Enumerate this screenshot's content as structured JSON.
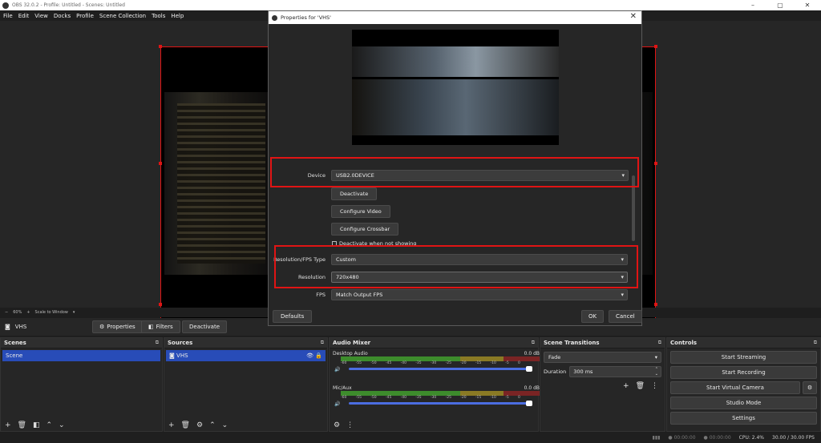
{
  "window": {
    "title": "OBS 32.0.2 - Profile: Untitled - Scenes: Untitled"
  },
  "menu": [
    "File",
    "Edit",
    "View",
    "Docks",
    "Profile",
    "Scene Collection",
    "Tools",
    "Help"
  ],
  "zoom": {
    "value": "60%",
    "scale_mode": "Scale to Window"
  },
  "source_bar": {
    "name": "VHS",
    "properties": "Properties",
    "filters": "Filters",
    "deactivate": "Deactivate"
  },
  "scenes": {
    "title": "Scenes",
    "items": [
      "Scene"
    ]
  },
  "sources": {
    "title": "Sources",
    "items": [
      "VHS"
    ]
  },
  "mixer": {
    "title": "Audio Mixer",
    "tracks": [
      {
        "name": "Desktop Audio",
        "db": "0.0 dB"
      },
      {
        "name": "Mic/Aux",
        "db": "0.0 dB"
      }
    ],
    "ticks": [
      "-60",
      "-55",
      "-50",
      "-45",
      "-40",
      "-35",
      "-30",
      "-25",
      "-20",
      "-15",
      "-10",
      "-5",
      "0"
    ]
  },
  "transitions": {
    "title": "Scene Transitions",
    "type": "Fade",
    "duration_label": "Duration",
    "duration_value": "300 ms"
  },
  "controls": {
    "title": "Controls",
    "buttons": [
      "Start Streaming",
      "Start Recording",
      "Start Virtual Camera",
      "Studio Mode",
      "Settings"
    ]
  },
  "status": {
    "time1": "00:00:00",
    "time2": "00:00:00",
    "cpu": "CPU: 2.4%",
    "fps": "30.00 / 30.00 FPS"
  },
  "dialog": {
    "title": "Properties for 'VHS'",
    "device_label": "Device",
    "device_value": "USB2.0DEVICE",
    "deactivate": "Deactivate",
    "configure_video": "Configure Video",
    "configure_crossbar": "Configure Crossbar",
    "deactivate_when_not_showing": "Deactivate when not showing",
    "res_type_label": "Resolution/FPS Type",
    "res_type_value": "Custom",
    "resolution_label": "Resolution",
    "resolution_value": "720x480",
    "fps_label": "FPS",
    "fps_value": "Match Output FPS",
    "defaults": "Defaults",
    "ok": "OK",
    "cancel": "Cancel"
  },
  "colors": {
    "accent": "#284cb8",
    "highlight": "#e01414"
  }
}
